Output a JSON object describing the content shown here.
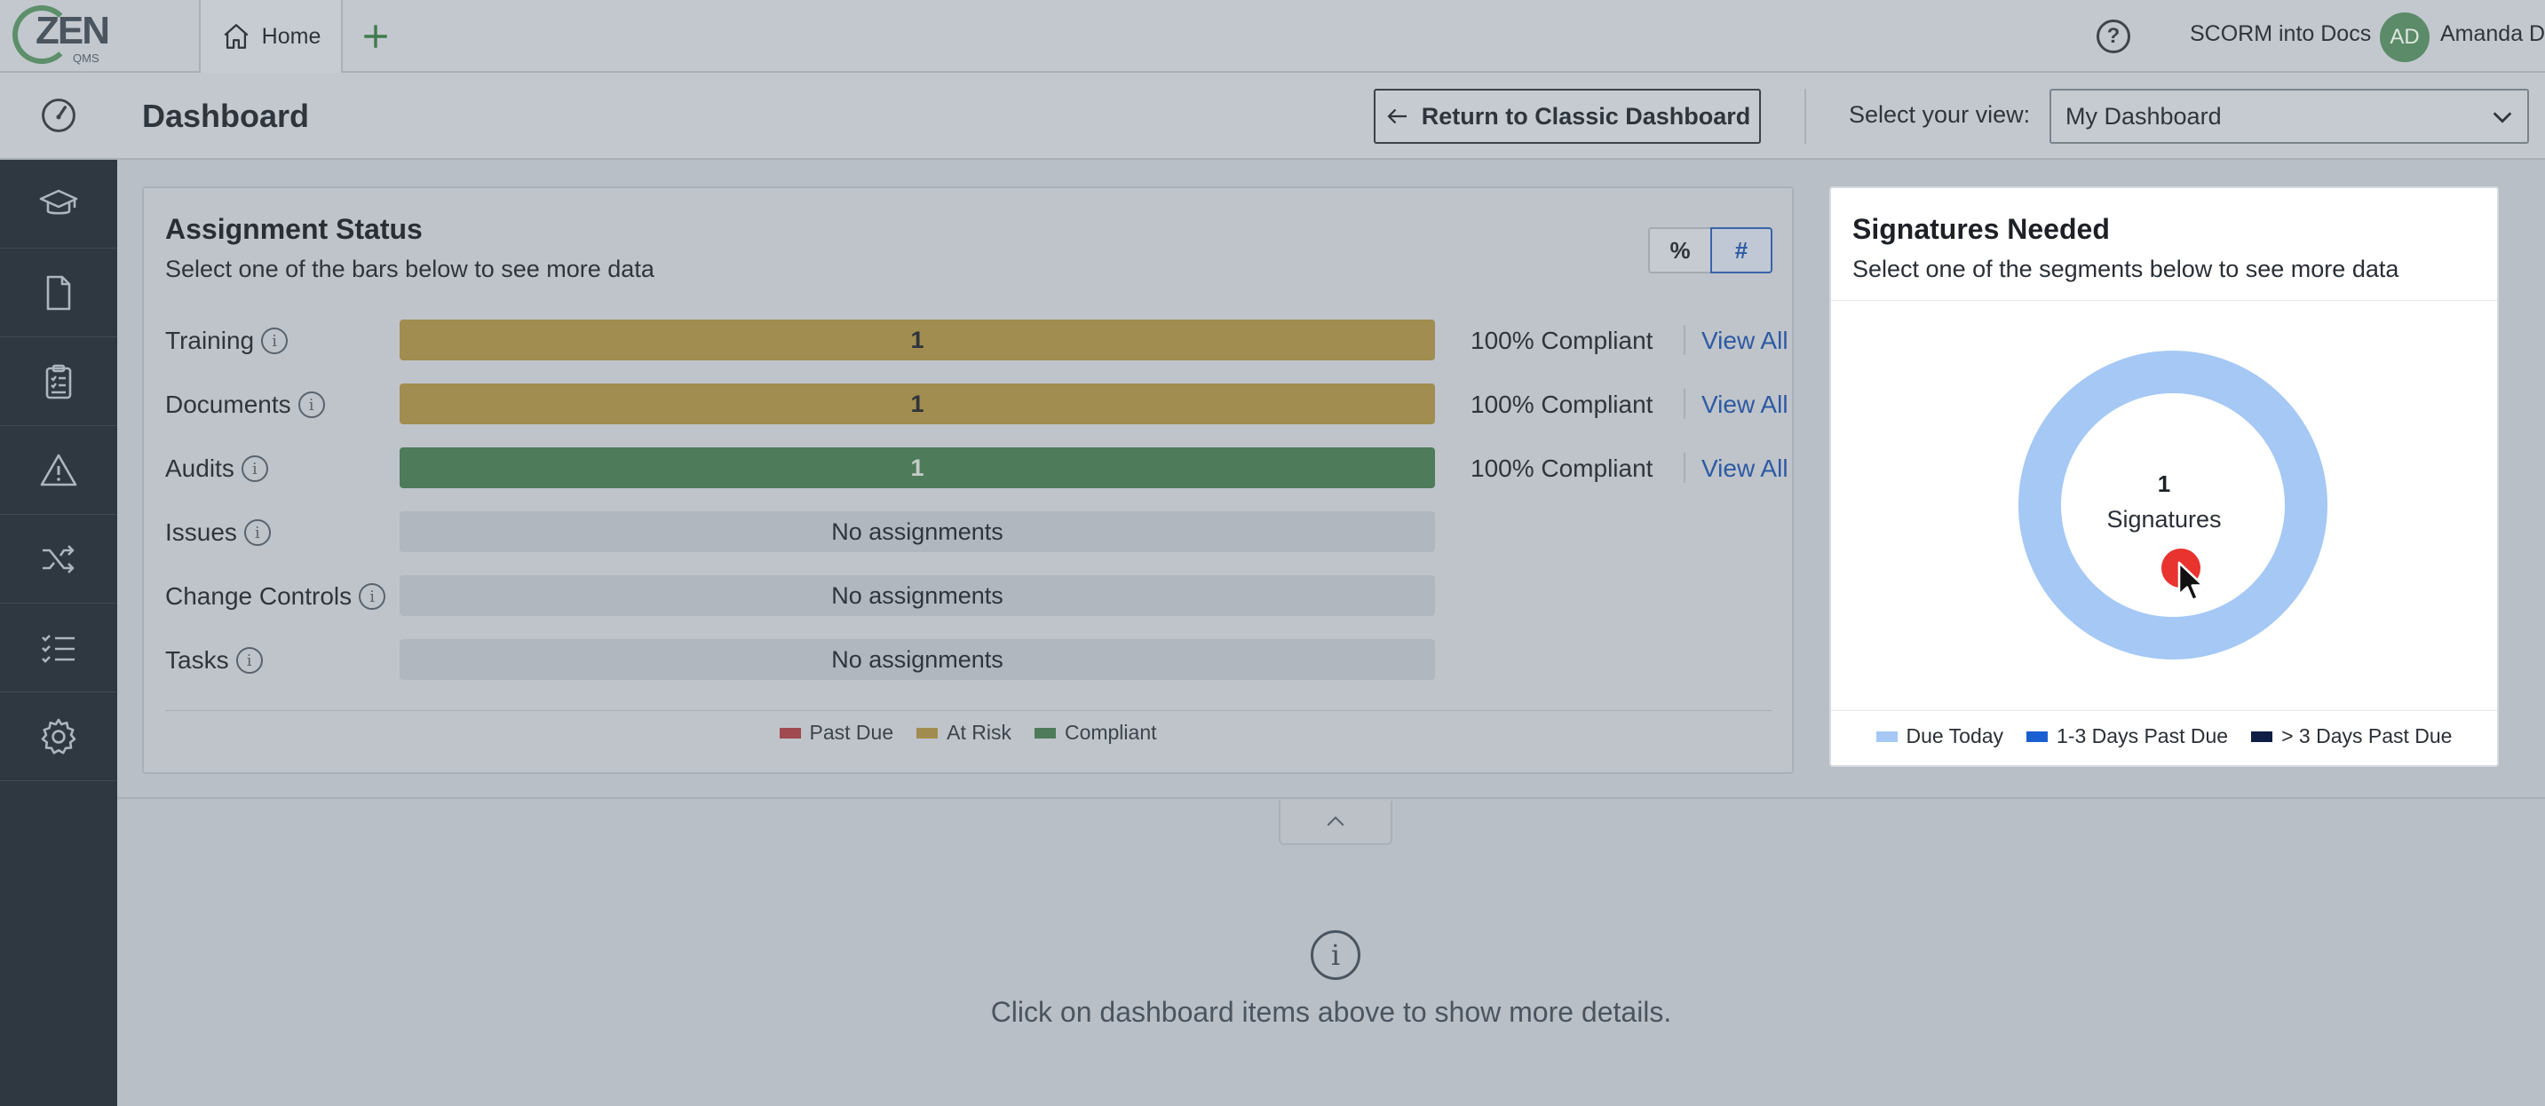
{
  "app": {
    "logo_text": "ZEN",
    "logo_sub": "QMS",
    "home_tab": "Home",
    "org_name": "SCORM into Docs",
    "user_initials": "AD",
    "user_name": "Amanda D"
  },
  "header": {
    "title": "Dashboard",
    "classic_button": "Return to Classic Dashboard",
    "view_label": "Select your view:",
    "view_selected": "My Dashboard"
  },
  "assignment": {
    "title": "Assignment Status",
    "subtitle": "Select one of the bars below to see more data",
    "toggle_percent": "%",
    "toggle_count": "#",
    "rows": [
      {
        "label": "Training",
        "bar": "1",
        "status": "at-risk",
        "compliance": "100% Compliant",
        "link": "View All"
      },
      {
        "label": "Documents",
        "bar": "1",
        "status": "at-risk",
        "compliance": "100% Compliant",
        "link": "View All"
      },
      {
        "label": "Audits",
        "bar": "1",
        "status": "compliant",
        "compliance": "100% Compliant",
        "link": "View All"
      },
      {
        "label": "Issues",
        "bar": "No assignments",
        "status": "none"
      },
      {
        "label": "Change Controls",
        "bar": "No assignments",
        "status": "none"
      },
      {
        "label": "Tasks",
        "bar": "No assignments",
        "status": "none"
      }
    ],
    "legend": [
      {
        "label": "Past Due",
        "color": "#a04a4f"
      },
      {
        "label": "At Risk",
        "color": "#a18d4f"
      },
      {
        "label": "Compliant",
        "color": "#4e7b59"
      }
    ]
  },
  "signatures": {
    "title": "Signatures Needed",
    "subtitle": "Select one of the segments below to see more data",
    "count": "1",
    "count_label": "Signatures",
    "legend": [
      {
        "label": "Due Today",
        "color": "#a5c8f5"
      },
      {
        "label": "1-3 Days Past Due",
        "color": "#1a5fd0"
      },
      {
        "label": "> 3 Days Past Due",
        "color": "#0f1e45"
      }
    ]
  },
  "bottom": {
    "message": "Click on dashboard items above to show more details."
  },
  "colors": {
    "accent": "#2d5aa3",
    "sidebar": "#2f3740"
  }
}
